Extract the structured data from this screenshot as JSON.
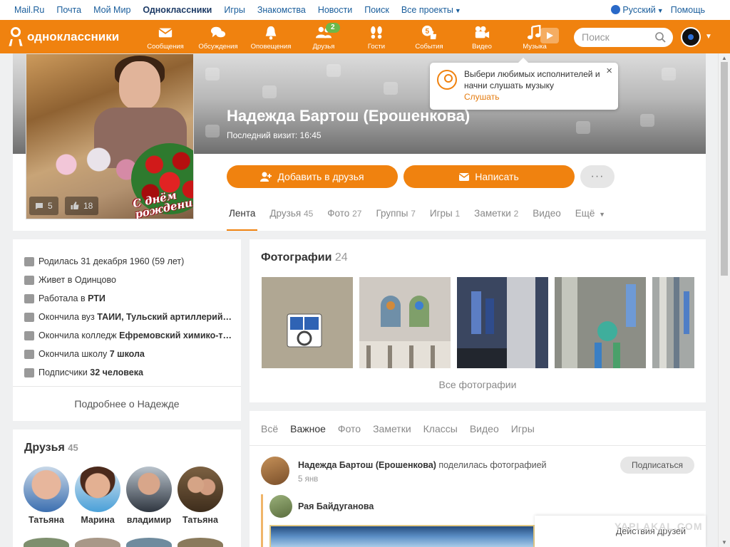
{
  "portal": {
    "links": [
      "Mail.Ru",
      "Почта",
      "Мой Мир",
      "Одноклассники",
      "Игры",
      "Знакомства",
      "Новости",
      "Поиск",
      "Все проекты"
    ],
    "current_index": 3,
    "language": "Русский",
    "help": "Помощь"
  },
  "toolbar": {
    "logo": "одноклассники",
    "nav": [
      {
        "label": "Сообщения",
        "icon": "envelope-icon"
      },
      {
        "label": "Обсуждения",
        "icon": "chat-bubbles-icon"
      },
      {
        "label": "Оповещения",
        "icon": "bell-icon"
      },
      {
        "label": "Друзья",
        "icon": "people-icon",
        "badge": "2"
      },
      {
        "label": "Гости",
        "icon": "footprints-icon"
      },
      {
        "label": "События",
        "icon": "thumbs-up-icon",
        "badge_num": "5"
      },
      {
        "label": "Видео",
        "icon": "camera-icon"
      },
      {
        "label": "Музыка",
        "icon": "music-note-icon"
      }
    ],
    "search_placeholder": "Поиск",
    "colors": {
      "brand": "#f0820f",
      "badge": "#6cb84a"
    }
  },
  "profile": {
    "name": "Надежда Бартош (Ерошенкова)",
    "last_visit": "Последний визит: 16:45",
    "photo_caption": "С днём рождения!",
    "photo_comments": "5",
    "photo_likes": "18",
    "add_friend": "Добавить в друзья",
    "write": "Написать",
    "more": "···",
    "tabs": [
      {
        "label": "Лента",
        "count": ""
      },
      {
        "label": "Друзья",
        "count": "45"
      },
      {
        "label": "Фото",
        "count": "27"
      },
      {
        "label": "Группы",
        "count": "7"
      },
      {
        "label": "Игры",
        "count": "1"
      },
      {
        "label": "Заметки",
        "count": "2"
      },
      {
        "label": "Видео",
        "count": ""
      },
      {
        "label": "Ещё",
        "count": ""
      }
    ]
  },
  "tooltip": {
    "text": "Выбери любимых исполнителей и начни слушать музыку",
    "link": "Слушать",
    "close": "×"
  },
  "about": {
    "rows": [
      {
        "icon": "calendar-icon",
        "text": "Родилась 31 декабря 1960 (59 лет)",
        "bold": ""
      },
      {
        "icon": "home-icon",
        "text": "Живет в Одинцово",
        "bold": ""
      },
      {
        "icon": "briefcase-icon",
        "text": "Работала в ",
        "bold": "РТИ"
      },
      {
        "icon": "graduation-cap-icon",
        "text": "Окончила вуз ",
        "bold": "ТАИИ, Тульский артиллерий…"
      },
      {
        "icon": "graduation-cap-icon",
        "text": "Окончила колледж ",
        "bold": "Ефремовский химико-т…"
      },
      {
        "icon": "school-icon",
        "text": "Окончила школу ",
        "bold": "7 школа"
      },
      {
        "icon": "rss-icon",
        "text": "Подписчики ",
        "bold": "32 человека"
      }
    ],
    "more": "Подробнее о Надежде"
  },
  "friends": {
    "title": "Друзья",
    "count": "45",
    "items": [
      {
        "name": "Татьяна"
      },
      {
        "name": "Марина"
      },
      {
        "name": "владимир"
      },
      {
        "name": "Татьяна"
      }
    ]
  },
  "photos": {
    "title": "Фотографии",
    "count": "24",
    "all": "Все фотографии"
  },
  "feed": {
    "tabs": [
      "Всё",
      "Важное",
      "Фото",
      "Заметки",
      "Классы",
      "Видео",
      "Игры"
    ],
    "active_index": 1,
    "post": {
      "author": "Надежда Бартош (Ерошенкова)",
      "action": " поделилась фотографией",
      "time": "5 янв",
      "subscribe": "Подписаться",
      "shared_author": "Рая Байдуганова"
    }
  },
  "friend_actions": "Действия друзей",
  "watermark": "YAPLAKAL.COM"
}
